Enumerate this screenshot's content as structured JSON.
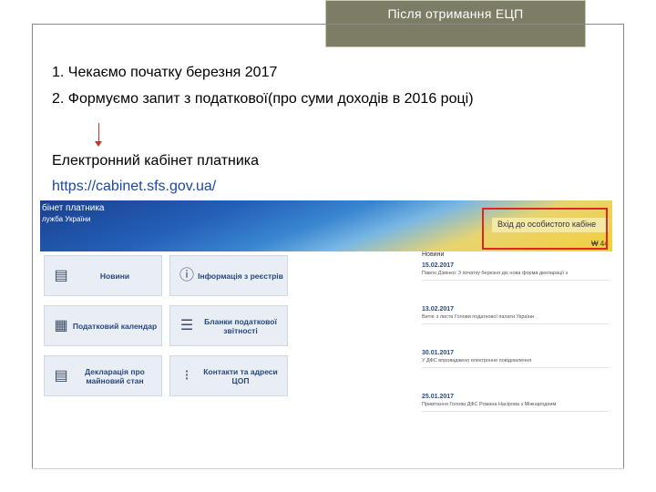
{
  "slide": {
    "title": "Після отримання ЕЦП",
    "line1": "1. Чекаємо початку березня 2017",
    "line2": "2. Формуємо запит з податкової(про суми доходів в 2016 році)",
    "line3": "Електронний кабінет платника",
    "url": "https://cabinet.sfs.gov.ua/"
  },
  "screenshot": {
    "banner_title": "бінет платника",
    "banner_subtitle": "лужба України",
    "login_label": "Вхід до особистого кабіне",
    "login_tail": "₩ 44",
    "tiles": [
      {
        "label": "Новини",
        "icon": "newspaper-icon"
      },
      {
        "label": "Інформація з реєстрів",
        "icon": "info-icon"
      },
      {
        "label": "Податковий календар",
        "icon": "calendar-icon"
      },
      {
        "label": "Бланки податкової звітності",
        "icon": "forms-icon"
      },
      {
        "label": "Декларація про майновий стан",
        "icon": "declaration-icon"
      },
      {
        "label": "Контакти та адреси ЦОП",
        "icon": "contacts-icon"
      }
    ],
    "news_header": "Новини",
    "news": [
      {
        "date": "15.02.2017",
        "text": "Павло Дзвінко: 3 початку березня діє нова форма декларації з"
      },
      {
        "date": "13.02.2017",
        "text": "Витяг з листа Голови податкової палати України"
      },
      {
        "date": "30.01.2017",
        "text": "У ДФС впроваджено електронне повідомлення"
      },
      {
        "date": "25.01.2017",
        "text": "Привітання Голови ДФС Романа Насірова з Міжнародним"
      }
    ]
  }
}
